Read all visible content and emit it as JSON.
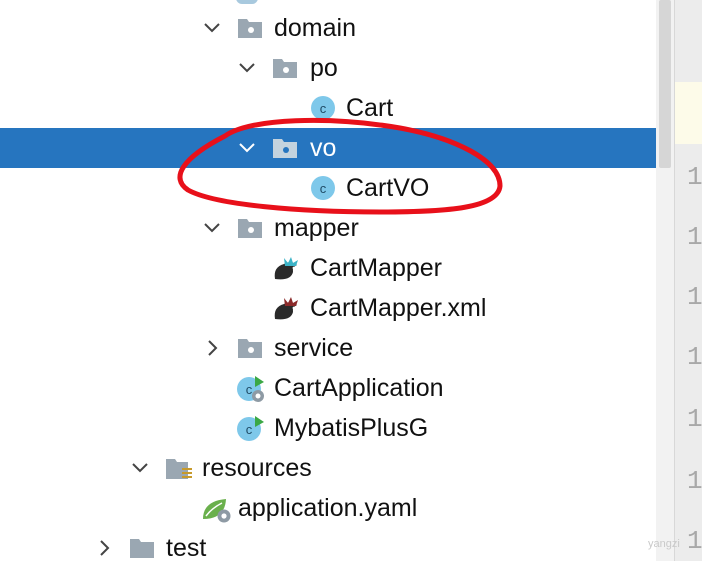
{
  "tree": {
    "items": [
      {
        "label": "domain",
        "icon": "package-folder-icon"
      },
      {
        "label": "po",
        "icon": "package-folder-icon"
      },
      {
        "label": "Cart",
        "icon": "java-class-icon"
      },
      {
        "label": "vo",
        "icon": "package-folder-icon",
        "selected": true
      },
      {
        "label": "CartVO",
        "icon": "java-class-icon"
      },
      {
        "label": "mapper",
        "icon": "package-folder-icon"
      },
      {
        "label": "CartMapper",
        "icon": "mybatis-mapper-icon"
      },
      {
        "label": "CartMapper.xml",
        "icon": "mybatis-xml-icon"
      },
      {
        "label": "service",
        "icon": "package-folder-icon"
      },
      {
        "label": "CartApplication",
        "icon": "spring-boot-class-icon"
      },
      {
        "label": "MybatisPlusG",
        "icon": "runnable-class-icon"
      },
      {
        "label": "resources",
        "icon": "resources-folder-icon"
      },
      {
        "label": "application.yaml",
        "icon": "spring-config-icon"
      },
      {
        "label": "test",
        "icon": "folder-icon"
      }
    ]
  },
  "gutter": {
    "line_digits": [
      "1",
      "1",
      "1",
      "1",
      "1",
      "1",
      "1",
      "1",
      "1"
    ]
  },
  "watermark": "yangzi",
  "colors": {
    "selection": "#2675bf",
    "annotation": "#e8101a",
    "class_icon": "#7ec8ea"
  }
}
